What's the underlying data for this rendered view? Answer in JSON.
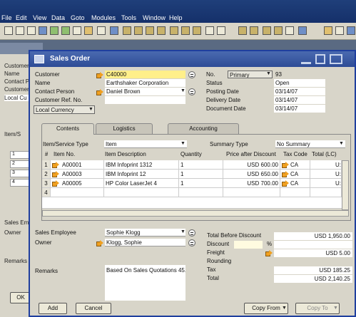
{
  "menu": [
    "File",
    "Edit",
    "View",
    "Data",
    "Goto",
    "Modules",
    "Tools",
    "Window",
    "Help"
  ],
  "colors": {
    "title_bar": "#2e4c96",
    "accent_field": "#ffef8a",
    "link_arrow": "#f0a020"
  },
  "bg_window": {
    "labels": [
      "Customer",
      "Name",
      "Contact P",
      "Customer",
      "Local Cu"
    ],
    "item_label": "Item/S",
    "rows": [
      "1",
      "2",
      "3",
      "4"
    ],
    "sales_label": "Sales Emp",
    "owner_label": "Owner",
    "remarks_label": "Remarks",
    "ok_label": "OK"
  },
  "window": {
    "title": "Sales Order"
  },
  "header_left": {
    "customer": {
      "label": "Customer",
      "value": "C40000"
    },
    "name": {
      "label": "Name",
      "value": "Earthshaker Corporation"
    },
    "contact": {
      "label": "Contact Person",
      "value": "Daniel Brown"
    },
    "ref": {
      "label": "Customer Ref. No.",
      "value": ""
    },
    "currency": {
      "label": "Local Currency"
    }
  },
  "header_right": {
    "no": {
      "label": "No.",
      "series": "Primary",
      "value": "93"
    },
    "status": {
      "label": "Status",
      "value": "Open"
    },
    "posting": {
      "label": "Posting Date",
      "value": "03/14/07"
    },
    "delivery": {
      "label": "Delivery Date",
      "value": "03/14/07"
    },
    "document": {
      "label": "Document Date",
      "value": "03/14/07"
    }
  },
  "tabs": [
    "Contents",
    "Logistics",
    "Accounting"
  ],
  "contents": {
    "service_type": {
      "label": "Item/Service Type",
      "value": "Item"
    },
    "summary_type": {
      "label": "Summary Type",
      "value": "No Summary"
    },
    "columns": [
      "#",
      "Item No.",
      "Item Description",
      "Quantity",
      "Price after Discount",
      "Tax Code",
      "Total (LC)"
    ],
    "rows": [
      {
        "n": "1",
        "item": "A00001",
        "desc": "IBM Infoprint 1312",
        "qty": "1",
        "price": "USD 600.00",
        "tax": "CA",
        "total": "U:"
      },
      {
        "n": "2",
        "item": "A00003",
        "desc": "IBM Infoprint 12",
        "qty": "1",
        "price": "USD 650.00",
        "tax": "CA",
        "total": "U:"
      },
      {
        "n": "3",
        "item": "A00005",
        "desc": "HP Color LaserJet 4",
        "qty": "1",
        "price": "USD 700.00",
        "tax": "CA",
        "total": "U:"
      },
      {
        "n": "4",
        "item": "",
        "desc": "",
        "qty": "",
        "price": "",
        "tax": "",
        "total": ""
      }
    ]
  },
  "footer_left": {
    "sales_employee": {
      "label": "Sales Employee",
      "value": "Sophie Klogg"
    },
    "owner": {
      "label": "Owner",
      "value": "Klogg, Sophie"
    },
    "remarks": {
      "label": "Remarks",
      "value": "Based On Sales Quotations 45."
    }
  },
  "totals": {
    "before_discount": {
      "label": "Total Before Discount",
      "value": "USD 1,950.00"
    },
    "discount": {
      "label": "Discount",
      "pct": "%",
      "value": ""
    },
    "freight": {
      "label": "Freight",
      "value": "USD 5.00"
    },
    "rounding": {
      "label": "Rounding",
      "value": ""
    },
    "tax": {
      "label": "Tax",
      "value": "USD 185.25"
    },
    "total": {
      "label": "Total",
      "value": "USD 2,140.25"
    }
  },
  "buttons": {
    "add": "Add",
    "cancel": "Cancel",
    "copy_from": "Copy From",
    "copy_to": "Copy To"
  }
}
